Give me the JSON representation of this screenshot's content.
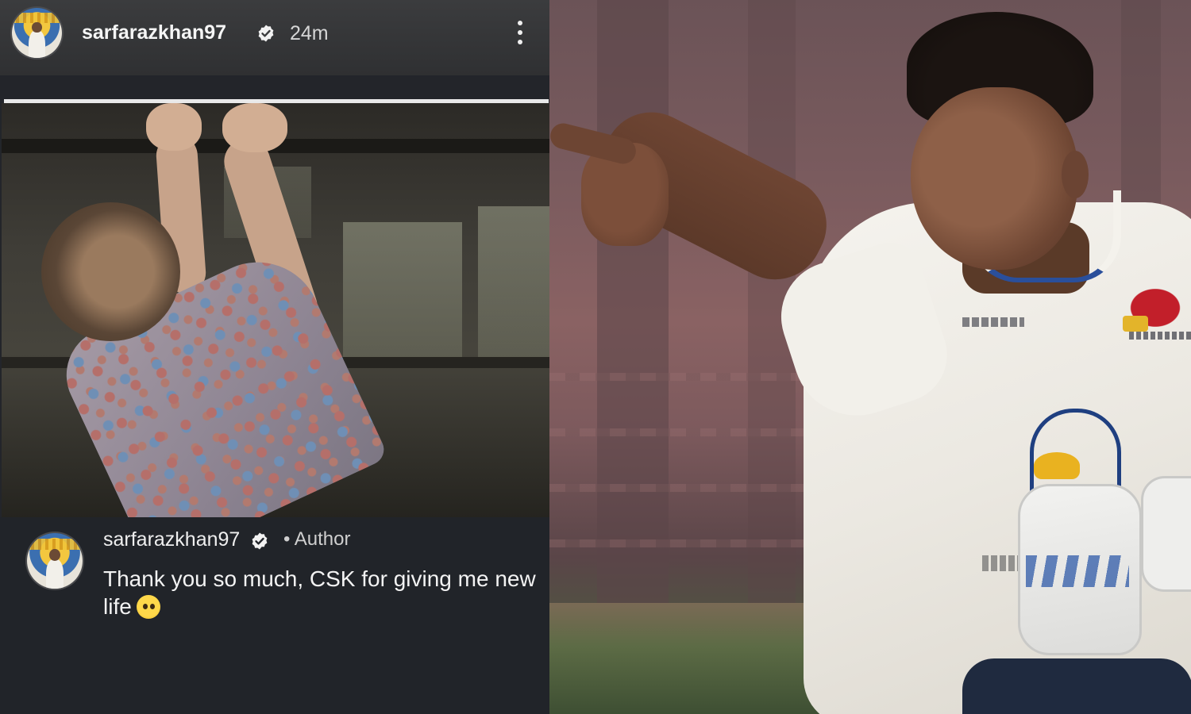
{
  "story": {
    "header": {
      "username": "sarfarazkhan97",
      "time_ago": "24m",
      "more_icon": "more-vertical-icon",
      "verified_icon": "verified-badge-icon"
    },
    "progress": 1.0,
    "comment": {
      "username": "sarfarazkhan97",
      "author_tag": "• Author",
      "text": "Thank you so much, CSK for giving me new life",
      "emoji": "face-holding-back-tears-emoji"
    }
  },
  "colors": {
    "story_bg": "#23252a",
    "header_bg": "#3b3c3e",
    "verified_badge": "#ffffff",
    "jersey_trim": "#2a4f9b",
    "logo_red": "#c21f2a"
  }
}
